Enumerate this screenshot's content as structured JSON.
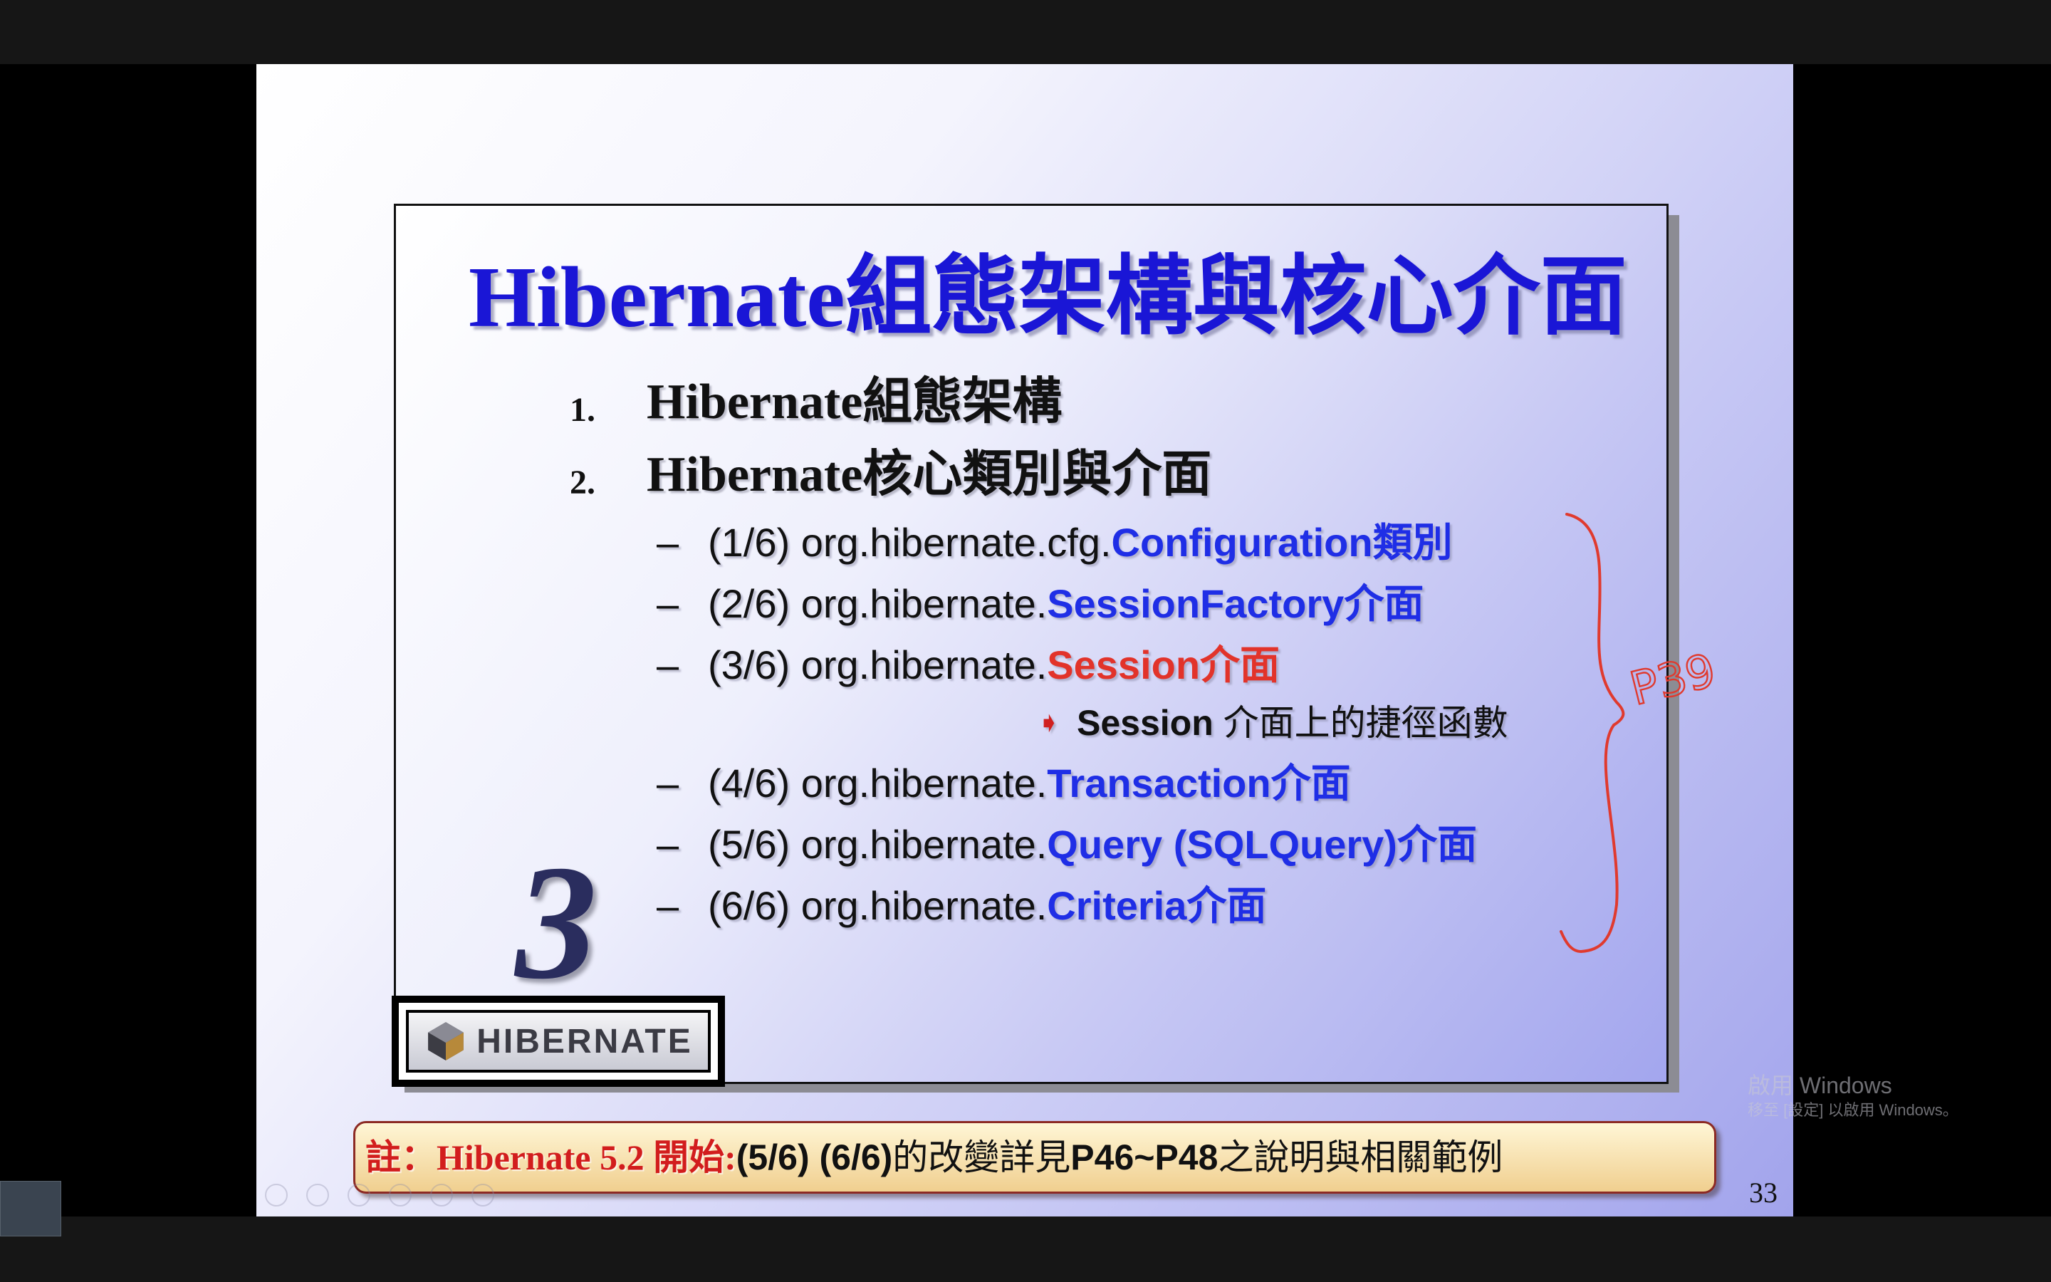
{
  "slide": {
    "title": "Hibernate組態架構與核心介面",
    "numbered_items": [
      {
        "num": "1.",
        "text": "Hibernate組態架構"
      },
      {
        "num": "2.",
        "text": "Hibernate核心類別與介面"
      }
    ],
    "sub_items": [
      {
        "dash": "–",
        "prefix": "(1/6) org.hibernate.cfg.",
        "key": "Configuration",
        "suffix": "類別"
      },
      {
        "dash": "–",
        "prefix": "(2/6) org.hibernate.",
        "key": "SessionFactory",
        "suffix": "介面"
      },
      {
        "dash": "–",
        "prefix": "(3/6) org.hibernate.",
        "key": "Session",
        "suffix": "介面"
      },
      {
        "dash": "–",
        "prefix": "(4/6) org.hibernate.",
        "key": "Transaction",
        "suffix": "介面"
      },
      {
        "dash": "–",
        "prefix": "(5/6) org.hibernate.",
        "key": "Query (SQLQuery)",
        "suffix": "介面"
      },
      {
        "dash": "–",
        "prefix": "(6/6) org.hibernate.",
        "key": "Criteria",
        "suffix": "介面"
      }
    ],
    "session_sub": {
      "keyword": "Session",
      "text": " 介面上的捷徑函數"
    },
    "chapter_number": "3",
    "logo_text": "HIBERNATE",
    "note": {
      "part1": "註：Hibernate 5.2 開始:",
      "part2": " (5/6) (6/6) ",
      "part3": " 的改變詳見 ",
      "part4": "P46~P48",
      "part5": " 之說明與相關範例"
    },
    "page_number": "33",
    "handwritten_annotation": "P39"
  },
  "watermark": {
    "line1": "啟用 Windows",
    "line2": "移至 [設定] 以啟用 Windows。"
  },
  "colors": {
    "title_blue": "#1a16d6",
    "keyword_blue": "#1f2ee6",
    "keyword_red": "#e2332a",
    "annotation_red": "#e03a2e"
  }
}
